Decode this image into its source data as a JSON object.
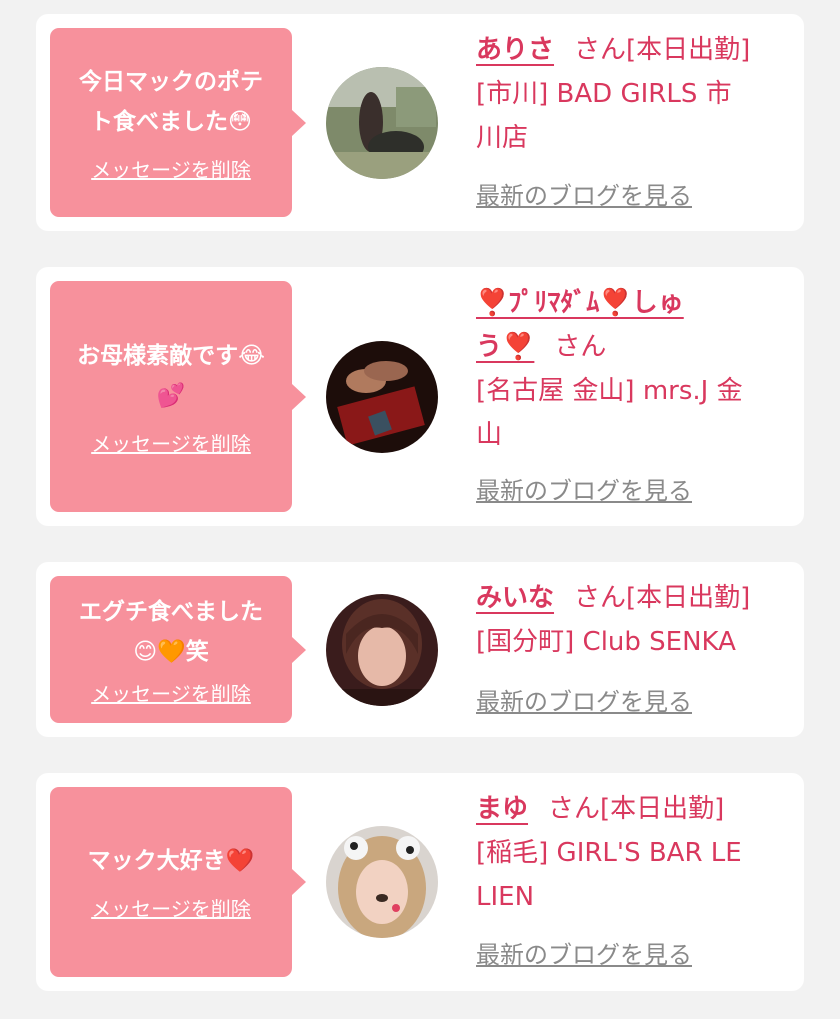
{
  "delete_label": "メッセージを削除",
  "blog_label": "最新のブログを見る",
  "san": "さん",
  "cards": [
    {
      "message_line1": "今日マックのポテ",
      "message_line2": "ト食べました😳",
      "name": "ありさ",
      "status": "[本日出勤]",
      "shop_line1": "[市川] BAD GIRLS 市",
      "shop_line2": "川店"
    },
    {
      "message_line1": "お母様素敵です😂",
      "message_line2": "💕",
      "name_line1": "❣️ﾌﾟﾘﾏﾀﾞﾑ❣️しゅ",
      "name_line2": "う❣️",
      "shop_line1": "[名古屋 金山] mrs.J 金",
      "shop_line2": "山"
    },
    {
      "message_line1": "エグチ食べました",
      "message_line2": "😊🧡笑",
      "name": "みいな",
      "status": "[本日出勤]",
      "shop_line1": "[国分町] Club SENKA"
    },
    {
      "message_line1": "マック大好き❤️",
      "name": "まゆ",
      "status": "[本日出勤]",
      "shop_line1": "[稲毛] GIRL'S BAR LE",
      "shop_line2": "LIEN"
    }
  ]
}
